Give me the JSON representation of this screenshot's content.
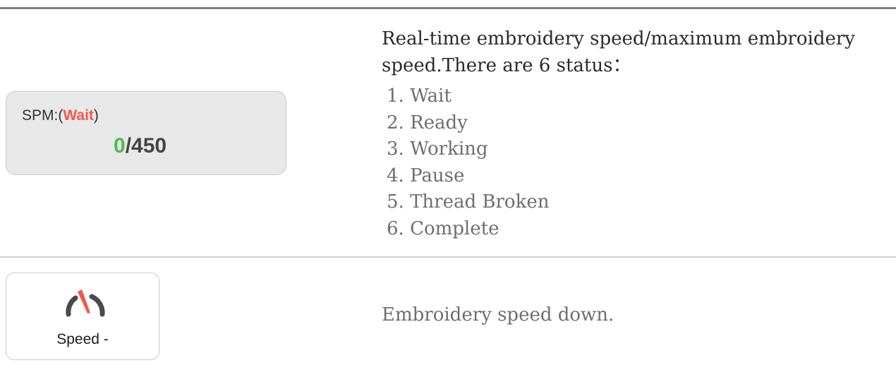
{
  "spm_panel": {
    "label_prefix": "SPM:(",
    "status": "Wait",
    "label_suffix": ")",
    "current_speed": "0",
    "separator": "/",
    "max_speed": "450",
    "colors": {
      "status": "#ef5a4b",
      "current_speed": "#4cbb4c"
    }
  },
  "description": {
    "title": "Real-time embroidery speed/maximum embroidery speed.There are 6 status：",
    "statuses": [
      "1. Wait",
      "2. Ready",
      "3. Working",
      "4. Pause",
      "5. Thread Broken",
      "6. Complete"
    ]
  },
  "speed_button": {
    "label": "Speed -",
    "icon": "speedometer-icon",
    "description": "Embroidery speed down."
  }
}
